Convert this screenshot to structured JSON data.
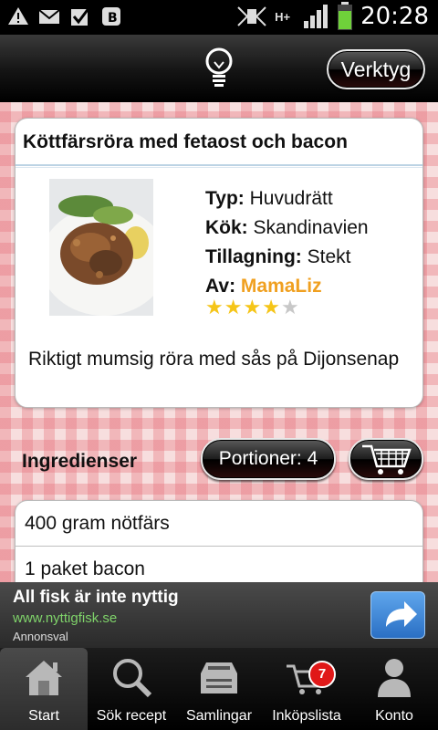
{
  "status_bar": {
    "time": "20:28",
    "network": "H+",
    "icons": [
      "warning-icon",
      "mail-icon",
      "check-icon",
      "blogger-icon",
      "vibrate-icon",
      "signal-icon",
      "battery-icon"
    ]
  },
  "action_bar": {
    "tools_label": "Verktyg",
    "icons": [
      "lightbulb-icon"
    ]
  },
  "recipe": {
    "title": "Köttfärsröra med fetaost och bacon",
    "type_label": "Typ:",
    "type_value": "Huvudrätt",
    "cuisine_label": "Kök:",
    "cuisine_value": "Skandinavien",
    "method_label": "Tillagning:",
    "method_value": "Stekt",
    "author_label": "Av:",
    "author_value": "MamaLiz",
    "rating": 4,
    "rating_max": 5,
    "description": "Riktigt mumsig röra med sås på Dijonsenap"
  },
  "ingredients": {
    "header": "Ingredienser",
    "portions_label": "Portioner: 4",
    "items": [
      "400 gram nötfärs",
      "1 paket bacon"
    ]
  },
  "ad": {
    "title": "All fisk är inte nyttig",
    "url": "www.nyttigfisk.se",
    "label": "Annonsval"
  },
  "bottom_nav": {
    "tabs": [
      {
        "label": "Start",
        "icon": "home-icon"
      },
      {
        "label": "Sök recept",
        "icon": "search-icon"
      },
      {
        "label": "Samlingar",
        "icon": "collections-icon"
      },
      {
        "label": "Inköpslista",
        "icon": "cart-icon"
      },
      {
        "label": "Konto",
        "icon": "person-icon"
      }
    ],
    "cart_badge": "7"
  },
  "colors": {
    "author": "#f0a020",
    "star_filled": "#f5c518",
    "star_empty": "#c8c8c8",
    "ad_url": "#7fd36a",
    "badge": "#e01818"
  }
}
